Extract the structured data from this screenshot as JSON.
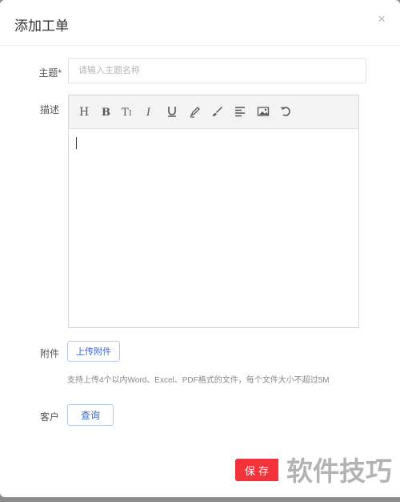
{
  "dialog": {
    "title": "添加工单",
    "close_glyph": "×"
  },
  "form": {
    "subject_label": "主题*",
    "subject_placeholder": "请输入主题名称",
    "description_label": "描述",
    "attachment_label": "附件",
    "upload_button": "上传附件",
    "attachment_hint": "支持上传4个以内Word、Excel、PDF格式的文件，每个文件大小不超过5M",
    "customer_label": "客户",
    "query_button": "查询",
    "save_button": "保存"
  },
  "toolbar": {
    "icons": [
      "heading-icon",
      "bold-icon",
      "font-size-icon",
      "italic-icon",
      "underline-icon",
      "highlight-icon",
      "brush-icon",
      "align-icon",
      "image-icon",
      "undo-icon"
    ]
  },
  "watermark": "软件技巧",
  "colors": {
    "accent": "#3d66c8",
    "save": "#f2333c",
    "backdrop": "#8c8c8c"
  }
}
